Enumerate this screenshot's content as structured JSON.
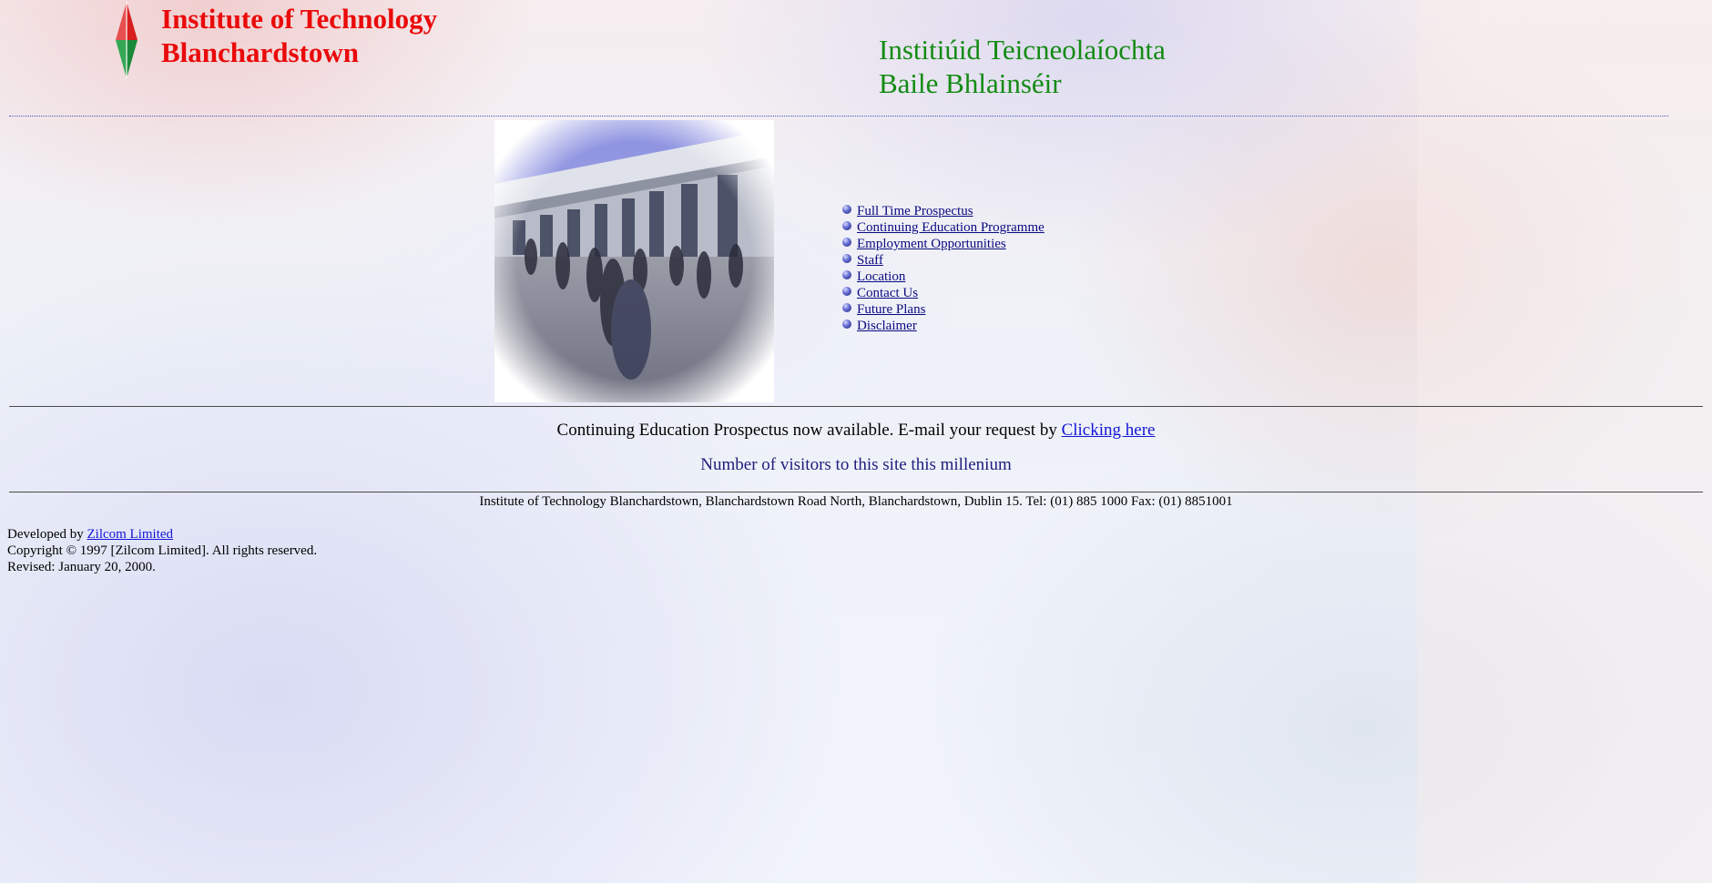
{
  "header": {
    "title_en_line1": "Institute of Technology",
    "title_en_line2": "Blanchardstown",
    "title_ga_line1": "Institiúid Teicneolaíochta",
    "title_ga_line2": "Baile Bhlainséir",
    "logo_icon": "red-green-compass-logo-icon"
  },
  "links": [
    {
      "label": "Full Time Prospectus"
    },
    {
      "label": "Continuing Education Programme"
    },
    {
      "label": "Employment Opportunities"
    },
    {
      "label": "Staff"
    },
    {
      "label": "Location"
    },
    {
      "label": "Contact Us"
    },
    {
      "label": "Future Plans"
    },
    {
      "label": "Disclaimer"
    }
  ],
  "announcement": {
    "text": "Continuing Education Prospectus now available. E-mail your request by ",
    "link_label": "Clicking here"
  },
  "visitors_text": "Number of visitors to this site this millenium",
  "address": "Institute of Technology Blanchardstown, Blanchardstown Road North, Blanchardstown, Dublin 15. Tel: (01) 885 1000 Fax: (01) 8851001",
  "footer": {
    "developed_by": "Developed by",
    "developer_link": "Zilcom Limited",
    "copyright": "Copyright © 1997 [Zilcom Limited]. All rights reserved.",
    "revised": "Revised: January 20, 2000."
  },
  "colors": {
    "title_en": "#ea0a0a",
    "title_ga": "#138b13",
    "nav_link": "#0a0a80",
    "text_link": "#1414d8"
  }
}
